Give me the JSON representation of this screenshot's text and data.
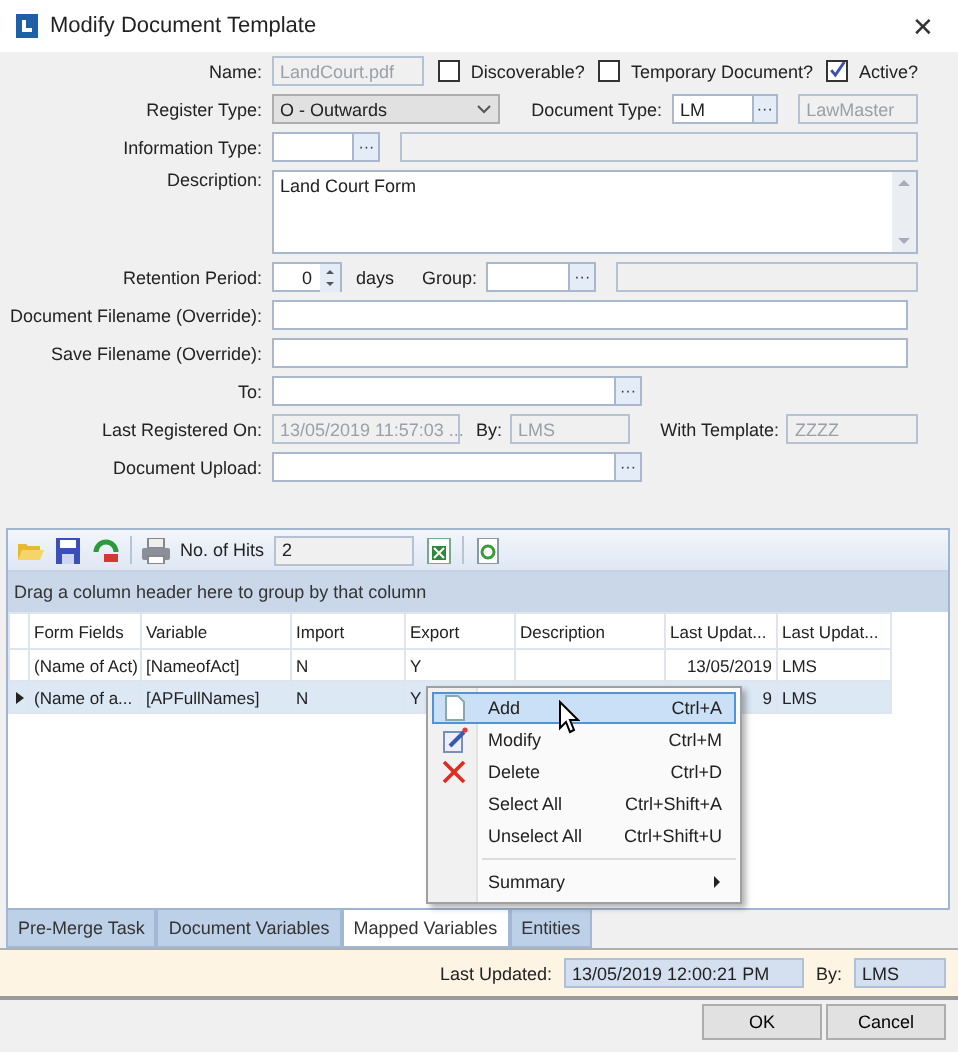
{
  "window": {
    "title": "Modify Document Template",
    "close": "✕"
  },
  "form": {
    "name": {
      "label": "Name:",
      "value": "LandCourt.pdf",
      "disabled": true
    },
    "flags": [
      {
        "label": "Discoverable?",
        "checked": false
      },
      {
        "label": "Temporary Document?",
        "checked": false
      },
      {
        "label": "Active?",
        "checked": true
      }
    ],
    "register_type": {
      "label": "Register Type:",
      "value": "O - Outwards"
    },
    "document_type": {
      "label": "Document Type:",
      "value": "LM",
      "button": "···",
      "description": "LawMaster"
    },
    "information_type": {
      "label": "Information Type:",
      "button": "···"
    },
    "description": {
      "label": "Description:",
      "value": "Land Court Form"
    },
    "retention": {
      "label": "Retention Period:",
      "value": "0",
      "unit": "days"
    },
    "group": {
      "label": "Group:",
      "button": "···"
    },
    "document_filename": {
      "label": "Document Filename (Override):"
    },
    "save_filename": {
      "label": "Save Filename (Override):"
    },
    "to": {
      "label": "To:",
      "button": "···"
    },
    "last_registered": {
      "label": "Last Registered On:",
      "value": "13/05/2019 11:57:03 ...",
      "by_label": "By:",
      "by": "LMS",
      "template_label": "With Template:",
      "template": "ZZZZ"
    },
    "document_upload": {
      "label": "Document Upload:",
      "button": "···"
    }
  },
  "grid": {
    "hits_label": "No. of Hits",
    "hits": "2",
    "group_hint": "Drag a column header here to group by that column",
    "columns": [
      "Form Fields",
      "Variable",
      "Import",
      "Export",
      "Description",
      "Last Updat...",
      "Last Updat..."
    ],
    "rows": [
      {
        "selected": false,
        "cells": [
          {
            "text": "(Name of Act)"
          },
          {
            "text": "[NameofAct]"
          },
          {
            "text": "N"
          },
          {
            "text": "Y"
          },
          {
            "text": ""
          },
          {
            "text": "13/05/2019"
          },
          {
            "text": "LMS"
          }
        ]
      },
      {
        "selected": true,
        "cells": [
          {
            "text": "(Name of a..."
          },
          {
            "text": "[APFullNames]"
          },
          {
            "text": "N"
          },
          {
            "text": "Y"
          },
          {
            "text": ""
          },
          {
            "text": "9"
          },
          {
            "text": "LMS"
          }
        ]
      }
    ]
  },
  "context_menu": [
    {
      "kind": "page",
      "label": "Add",
      "shortcut": "Ctrl+A",
      "highlighted": true
    },
    {
      "kind": "pencil",
      "label": "Modify",
      "shortcut": "Ctrl+M",
      "highlighted": false
    },
    {
      "kind": "cross",
      "label": "Delete",
      "shortcut": "Ctrl+D",
      "highlighted": false
    },
    {
      "kind": "plain",
      "label": "Select All",
      "shortcut": "Ctrl+Shift+A",
      "highlighted": false
    },
    {
      "kind": "plain",
      "label": "Unselect All",
      "shortcut": "Ctrl+Shift+U",
      "highlighted": false
    },
    {
      "kind": "submenu",
      "label": "Summary",
      "highlighted": false
    }
  ],
  "tabs": [
    {
      "label": "Pre-Merge Task",
      "selected": false
    },
    {
      "label": "Document Variables",
      "selected": false
    },
    {
      "label": "Mapped Variables",
      "selected": true
    },
    {
      "label": "Entities",
      "selected": false
    }
  ],
  "footer": {
    "updated_label": "Last Updated:",
    "updated": "13/05/2019 12:00:21 PM",
    "by_label": "By:",
    "by": "LMS"
  },
  "buttons": [
    "OK",
    "Cancel"
  ]
}
